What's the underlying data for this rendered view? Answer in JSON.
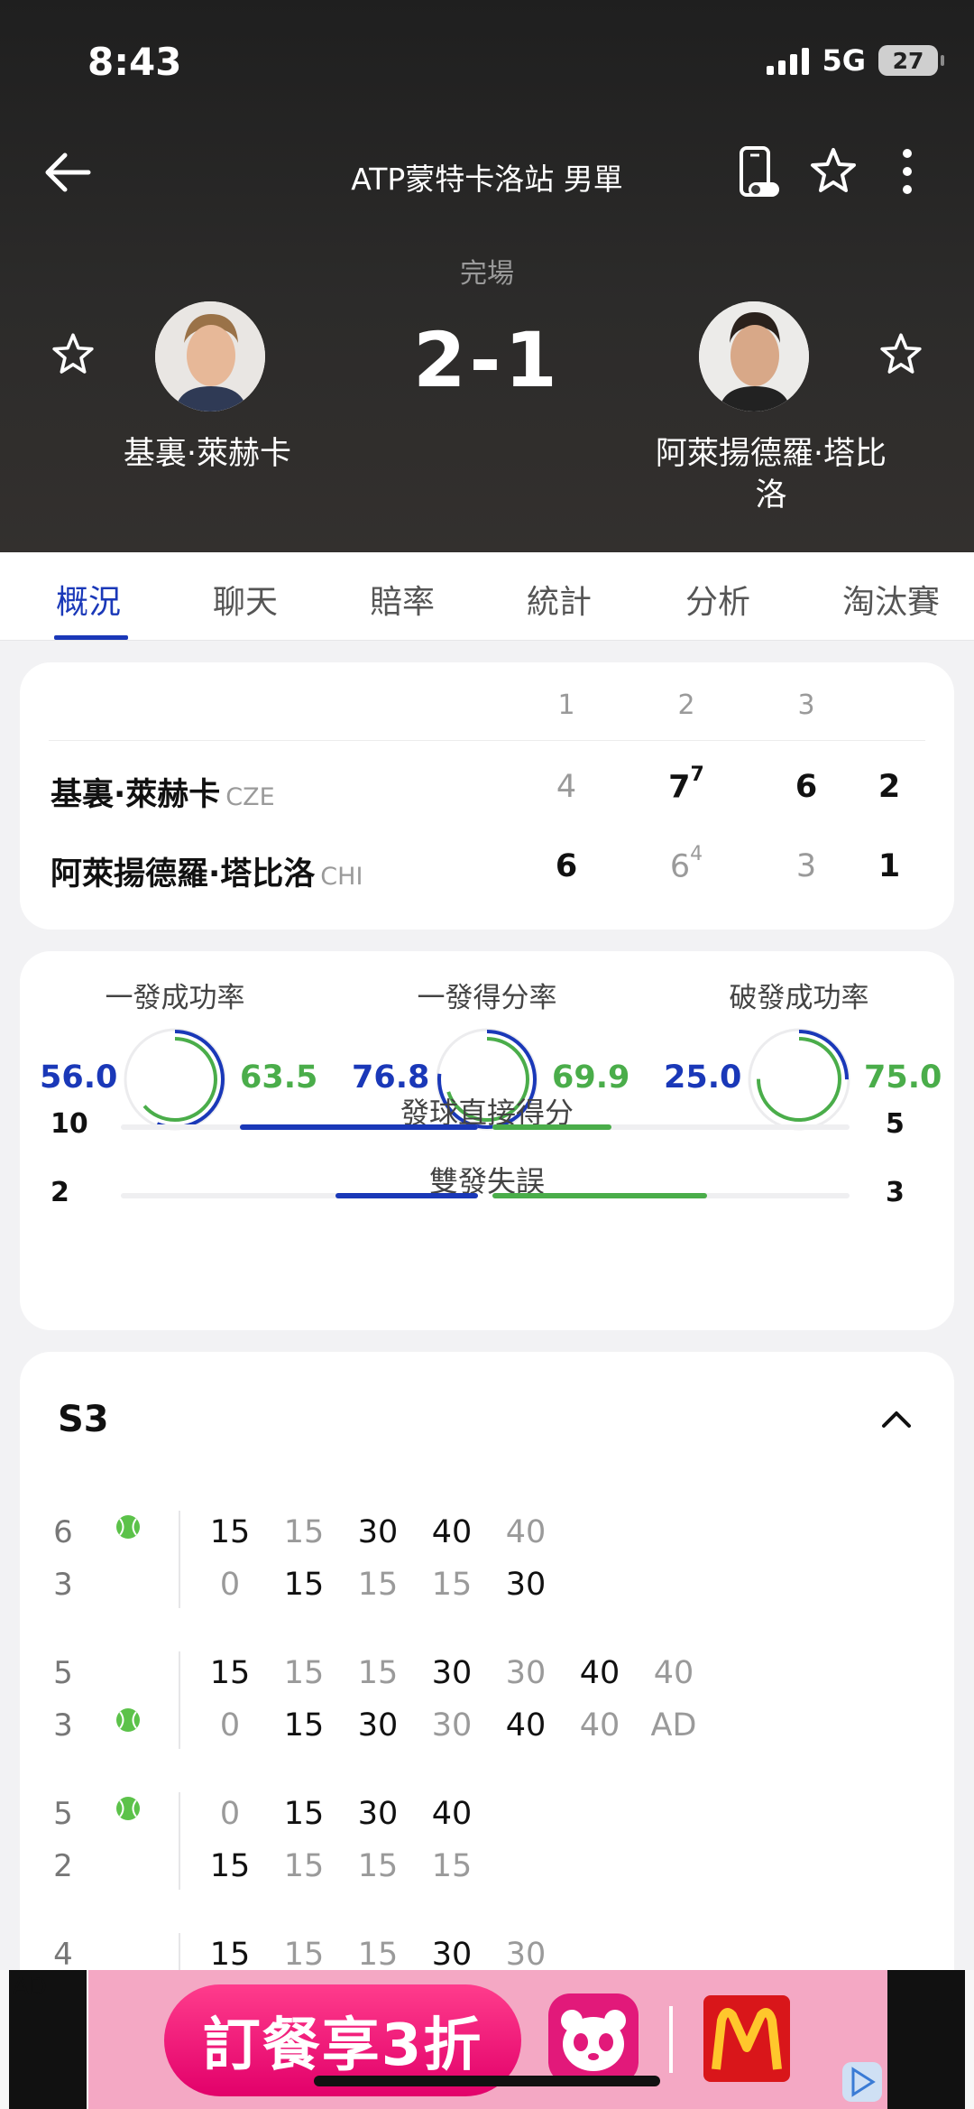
{
  "status_bar": {
    "time": "8:43",
    "network": "5G",
    "battery": "27"
  },
  "header": {
    "title": "ATP蒙特卡洛站 男單"
  },
  "match": {
    "status": "完場",
    "score": "2-1",
    "player1": {
      "name": "基裏·萊赫卡"
    },
    "player2": {
      "name_line1": "阿萊揚德羅·塔比",
      "name_line2": "洛"
    }
  },
  "tabs": [
    "概況",
    "聊天",
    "賠率",
    "統計",
    "分析",
    "淘汰賽"
  ],
  "scoreboard": {
    "set_headers": [
      "1",
      "2",
      "3"
    ],
    "rows": [
      {
        "name": "基裏·萊赫卡",
        "country": "CZE",
        "sets": [
          "4",
          "7",
          "6"
        ],
        "tb": [
          "",
          "7",
          ""
        ],
        "win": [
          false,
          true,
          true
        ],
        "total": "2"
      },
      {
        "name": "阿萊揚德羅·塔比洛",
        "country": "CHI",
        "sets": [
          "6",
          "6",
          "3"
        ],
        "tb": [
          "",
          "4",
          ""
        ],
        "win": [
          true,
          false,
          false
        ],
        "total": "1"
      }
    ]
  },
  "stats": {
    "rings": [
      {
        "title": "一發成功率",
        "left": "56.0",
        "right": "63.5"
      },
      {
        "title": "一發得分率",
        "left": "76.8",
        "right": "69.9"
      },
      {
        "title": "破發成功率",
        "left": "25.0",
        "right": "75.0"
      }
    ],
    "bars": [
      {
        "label": "發球直接得分",
        "left": "10",
        "right": "5",
        "left_value": 10,
        "right_value": 5
      },
      {
        "label": "雙發失誤",
        "left": "2",
        "right": "3",
        "left_value": 2,
        "right_value": 3
      }
    ]
  },
  "point_by_point": {
    "title": "S3",
    "games": [
      {
        "top_games": "6",
        "bottom_games": "3",
        "server": "top",
        "top_points": [
          "15",
          "15",
          "30",
          "40",
          "40"
        ],
        "bottom_points": [
          "0",
          "15",
          "15",
          "15",
          "30"
        ],
        "top_dark": [
          true,
          false,
          true,
          true,
          false
        ],
        "bottom_dark": [
          false,
          true,
          false,
          false,
          true
        ]
      },
      {
        "top_games": "5",
        "bottom_games": "3",
        "server": "bottom",
        "top_points": [
          "15",
          "15",
          "15",
          "30",
          "30",
          "40",
          "40"
        ],
        "bottom_points": [
          "0",
          "15",
          "30",
          "30",
          "40",
          "40",
          "AD"
        ],
        "top_dark": [
          true,
          false,
          false,
          true,
          false,
          true,
          false
        ],
        "bottom_dark": [
          false,
          true,
          true,
          false,
          true,
          false,
          false
        ]
      },
      {
        "top_games": "5",
        "bottom_games": "2",
        "server": "top",
        "top_points": [
          "0",
          "15",
          "30",
          "40"
        ],
        "bottom_points": [
          "15",
          "15",
          "15",
          "15"
        ],
        "top_dark": [
          false,
          true,
          true,
          true
        ],
        "bottom_dark": [
          true,
          false,
          false,
          false
        ]
      },
      {
        "top_games": "4",
        "bottom_games": "",
        "server": "",
        "top_points": [
          "15",
          "15",
          "15",
          "30",
          "30"
        ],
        "bottom_points": [],
        "top_dark": [
          true,
          false,
          false,
          true,
          false
        ],
        "bottom_dark": []
      }
    ]
  },
  "ad": {
    "tag": "AD",
    "headline": "訂餐享3折"
  },
  "colors": {
    "accent": "#1a38b8",
    "green": "#4aad4a",
    "muted": "#9a9a9a"
  },
  "icons": [
    "back-arrow-icon",
    "phone-toggle-icon",
    "star-icon",
    "more-vertical-icon",
    "tennis-ball-icon",
    "chevron-up-icon",
    "close-icon"
  ]
}
